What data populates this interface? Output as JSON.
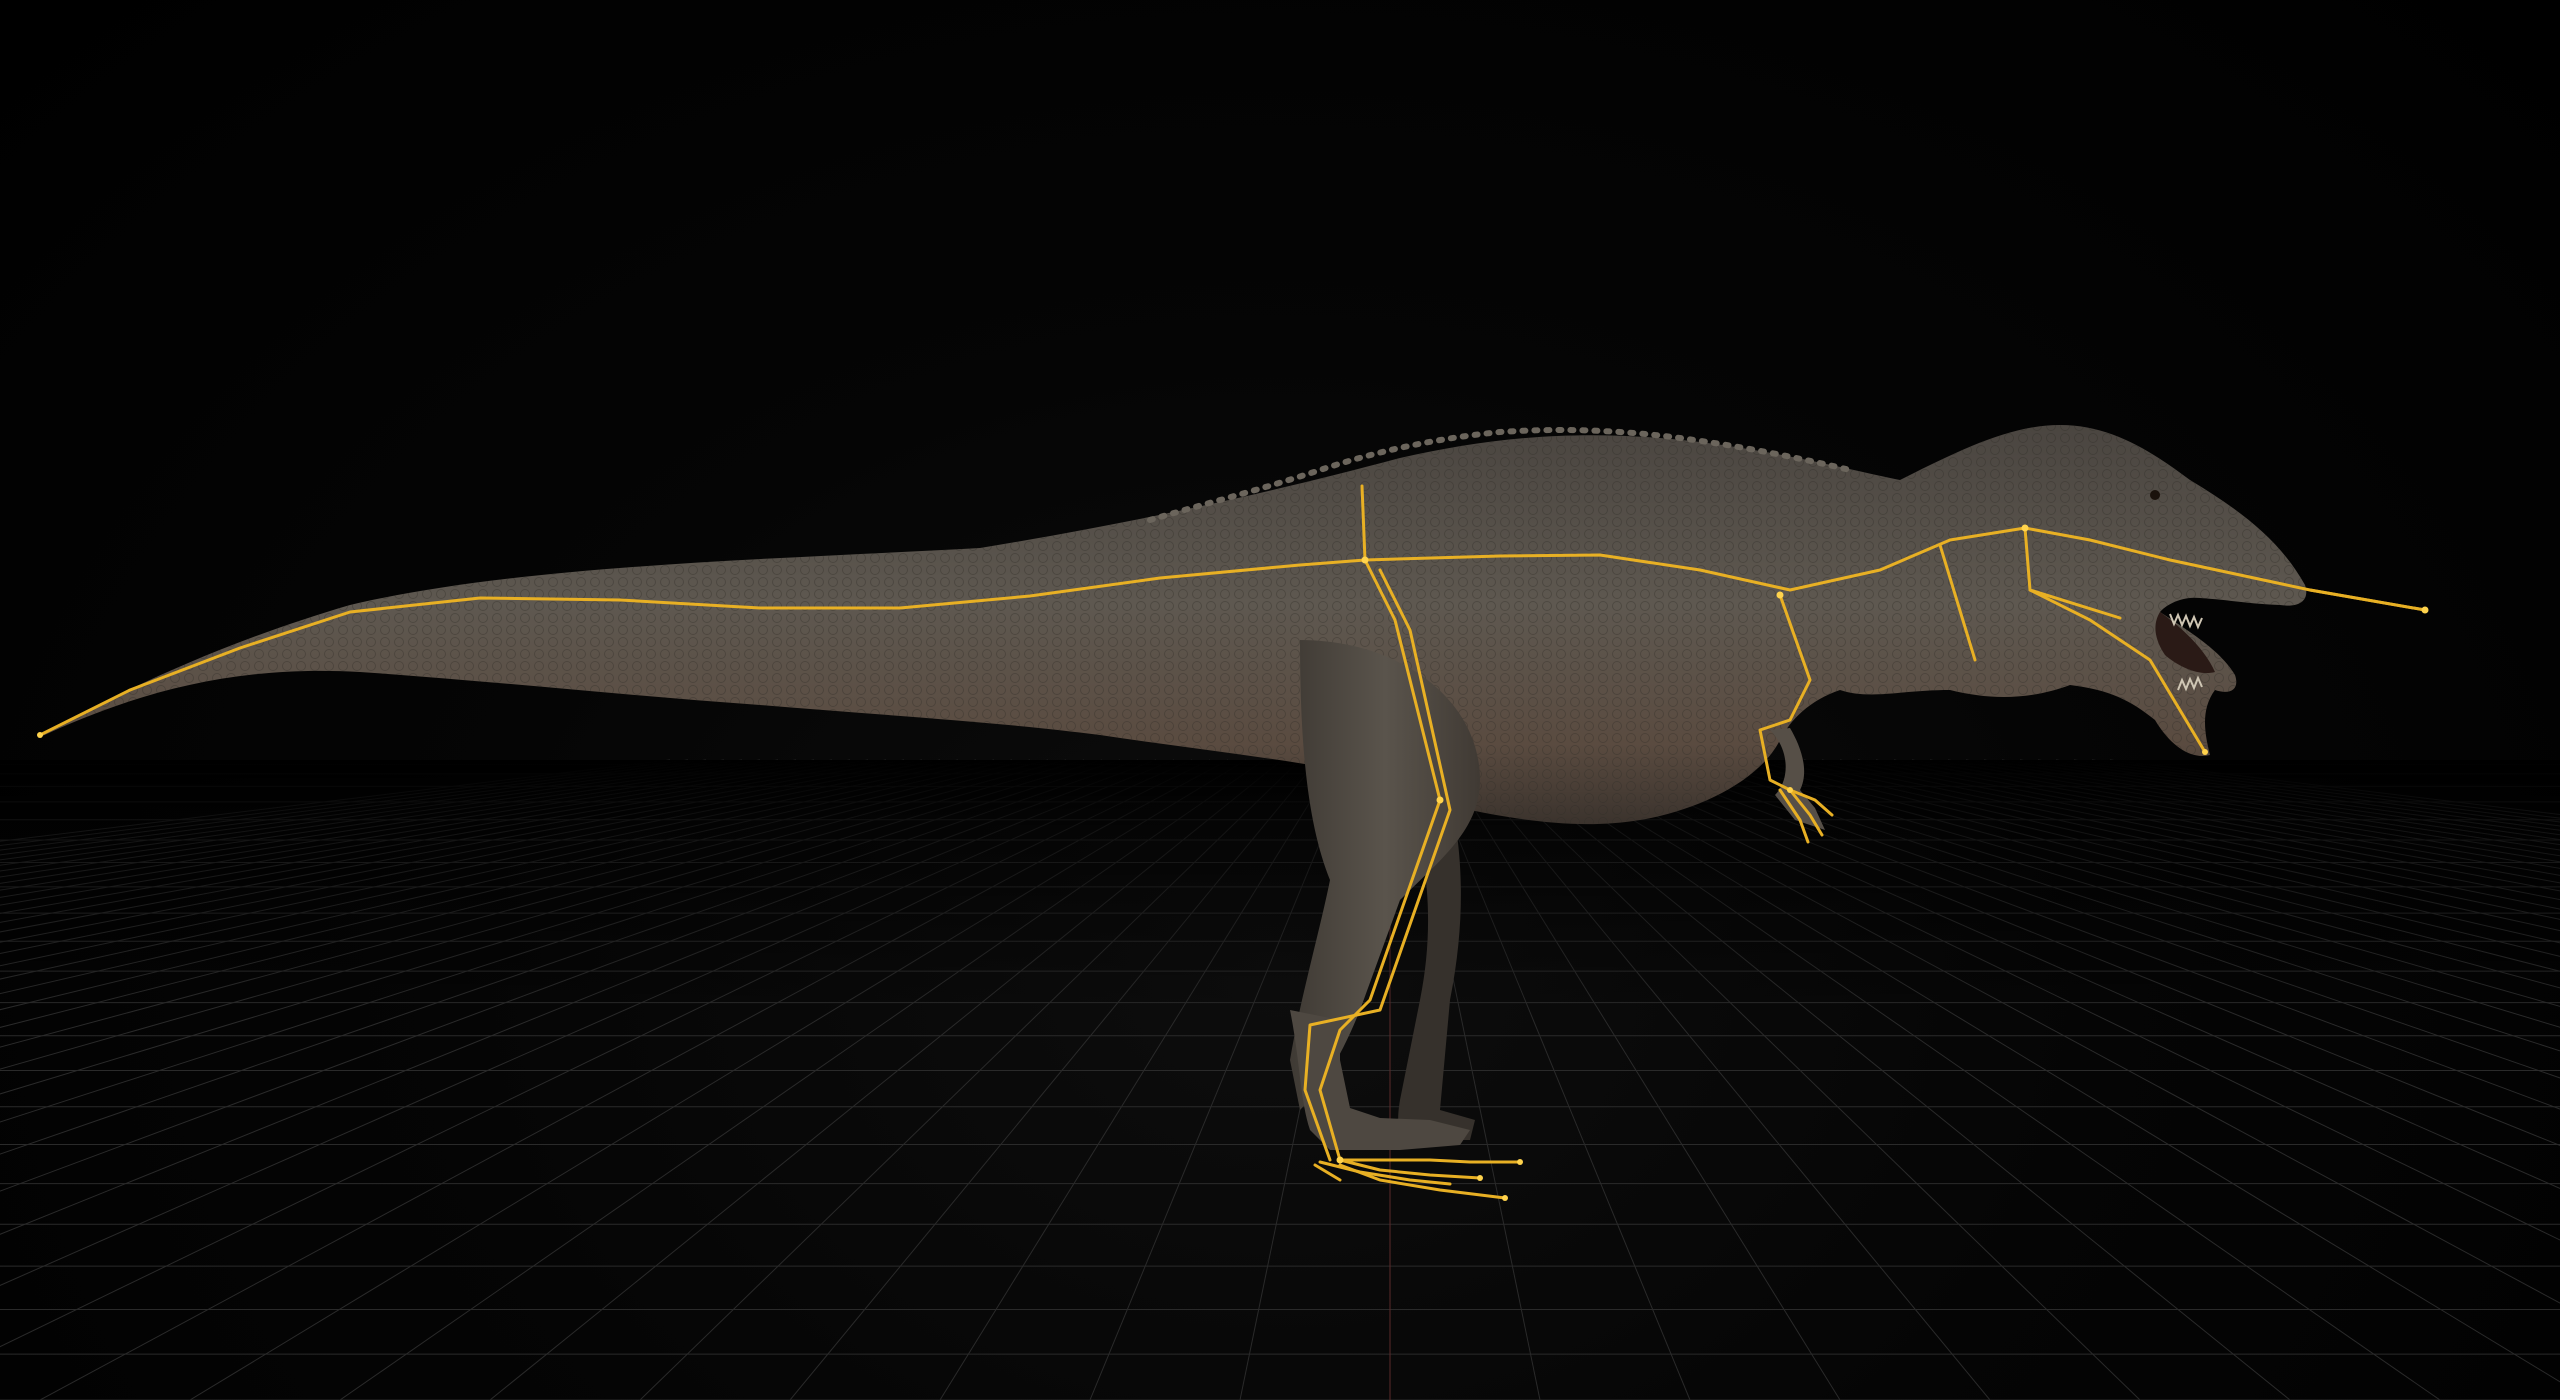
{
  "viewport": {
    "background_color": "#000000",
    "grid_color": "#2a2a2a",
    "grid_axis_color": "#5a2a2a"
  },
  "model": {
    "name_icon": "dinosaur-model",
    "body_color": "#5b554b",
    "body_shadow_color": "#3a352f",
    "belly_color": "#6a5a4a"
  },
  "skeleton": {
    "bone_color": "#e8b024",
    "joint_color": "#ffd34d",
    "visible": true
  }
}
